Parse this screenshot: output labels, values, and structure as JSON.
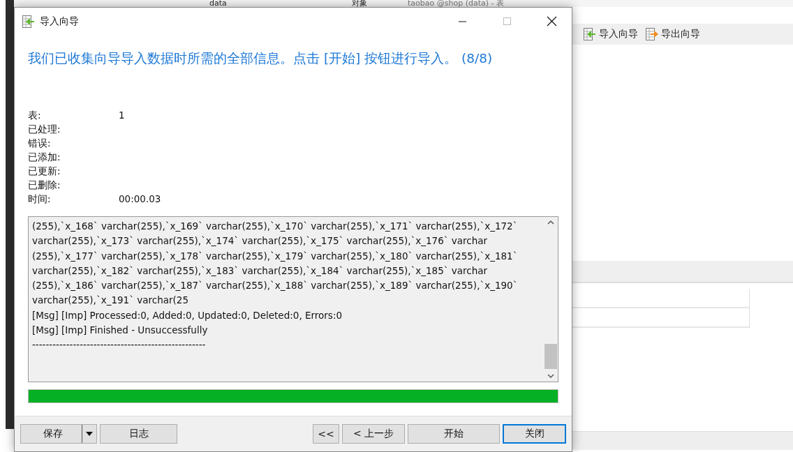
{
  "background_app": {
    "tree_item": "data",
    "tabs": [
      "对象",
      "taobao @shop (data) - 表"
    ],
    "toolbar": [
      {
        "label": "导入向导",
        "kind": "import"
      },
      {
        "label": "导出向导",
        "kind": "export"
      }
    ]
  },
  "dialog": {
    "title": "导入向导",
    "heading": "我们已收集向导导入数据时所需的全部信息。点击 [开始] 按钮进行导入。 (8/8)",
    "stats": [
      {
        "label": "表:",
        "value": "1"
      },
      {
        "label": "已处理:"
      },
      {
        "label": "错误:"
      },
      {
        "label": "已添加:"
      },
      {
        "label": "已更新:"
      },
      {
        "label": "已删除:"
      },
      {
        "label": "时间:",
        "value": "00:00.03"
      }
    ],
    "log": [
      "(255),`x_168` varchar(255),`x_169` varchar(255),`x_170` varchar(255),`x_171` varchar(255),`x_172`",
      "varchar(255),`x_173` varchar(255),`x_174` varchar(255),`x_175` varchar(255),`x_176` varchar",
      "(255),`x_177` varchar(255),`x_178` varchar(255),`x_179` varchar(255),`x_180` varchar(255),`x_181`",
      "varchar(255),`x_182` varchar(255),`x_183` varchar(255),`x_184` varchar(255),`x_185` varchar",
      "(255),`x_186` varchar(255),`x_187` varchar(255),`x_188` varchar(255),`x_189` varchar(255),`x_190`",
      "varchar(255),`x_191` varchar(25",
      "[Msg] [Imp] Processed:0, Added:0, Updated:0, Deleted:0, Errors:0",
      "[Msg] [Imp] Finished - Unsuccessfully",
      "---------------------------------------------------"
    ],
    "progress": {
      "level": 1
    },
    "buttons_left": [
      {
        "label": "保存",
        "kind": "split",
        "default": false
      },
      {
        "label": "日志",
        "kind": "plain",
        "default": false
      }
    ],
    "buttons_right": [
      {
        "label": "<<",
        "kind": "plain",
        "default": false
      },
      {
        "label": "< 上一步",
        "kind": "plain",
        "default": false
      },
      {
        "label": "开始",
        "kind": "plain",
        "default": false
      },
      {
        "label": "关闭",
        "kind": "plain",
        "default": true
      }
    ]
  }
}
